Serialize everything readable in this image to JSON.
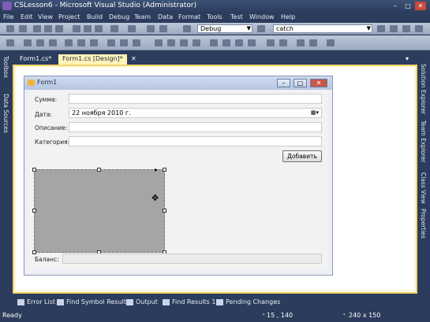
{
  "window": {
    "title": "CSLesson6 - Microsoft Visual Studio (Administrator)",
    "controls": [
      "–",
      "□",
      "✕"
    ]
  },
  "menu": [
    "File",
    "Edit",
    "View",
    "Project",
    "Build",
    "Debug",
    "Team",
    "Data",
    "Format",
    "Tools",
    "Test",
    "Window",
    "Help"
  ],
  "toolbar": {
    "config": "Debug",
    "find": "catch"
  },
  "left_panels": [
    "Toolbox",
    "Data Sources"
  ],
  "right_panels": [
    "Solution Explorer",
    "Team Explorer",
    "Class View",
    "Properties"
  ],
  "tabs": [
    {
      "label": "Form1.cs*"
    },
    {
      "label": "Form1.cs [Design]*"
    }
  ],
  "form": {
    "title": "Form1",
    "fields": [
      {
        "label": "Сумма:",
        "value": ""
      },
      {
        "label": "Дата:",
        "value": "22   ноября   2010 г."
      },
      {
        "label": "Описание:",
        "value": ""
      },
      {
        "label": "Категория:",
        "value": ""
      }
    ],
    "add_button": "Добавить",
    "balance_label": "Баланс:",
    "balance_value": ""
  },
  "bottom_tabs": [
    "Error List",
    "Find Symbol Results",
    "Output",
    "Find Results 1",
    "Pending Changes"
  ],
  "status": {
    "left": "Ready",
    "position": "15 , 140",
    "size": "240 x 150"
  },
  "colors": {
    "chrome": "#2b3c5c",
    "designer_border": "#f2d36c",
    "panel": "#a5a5a5"
  }
}
